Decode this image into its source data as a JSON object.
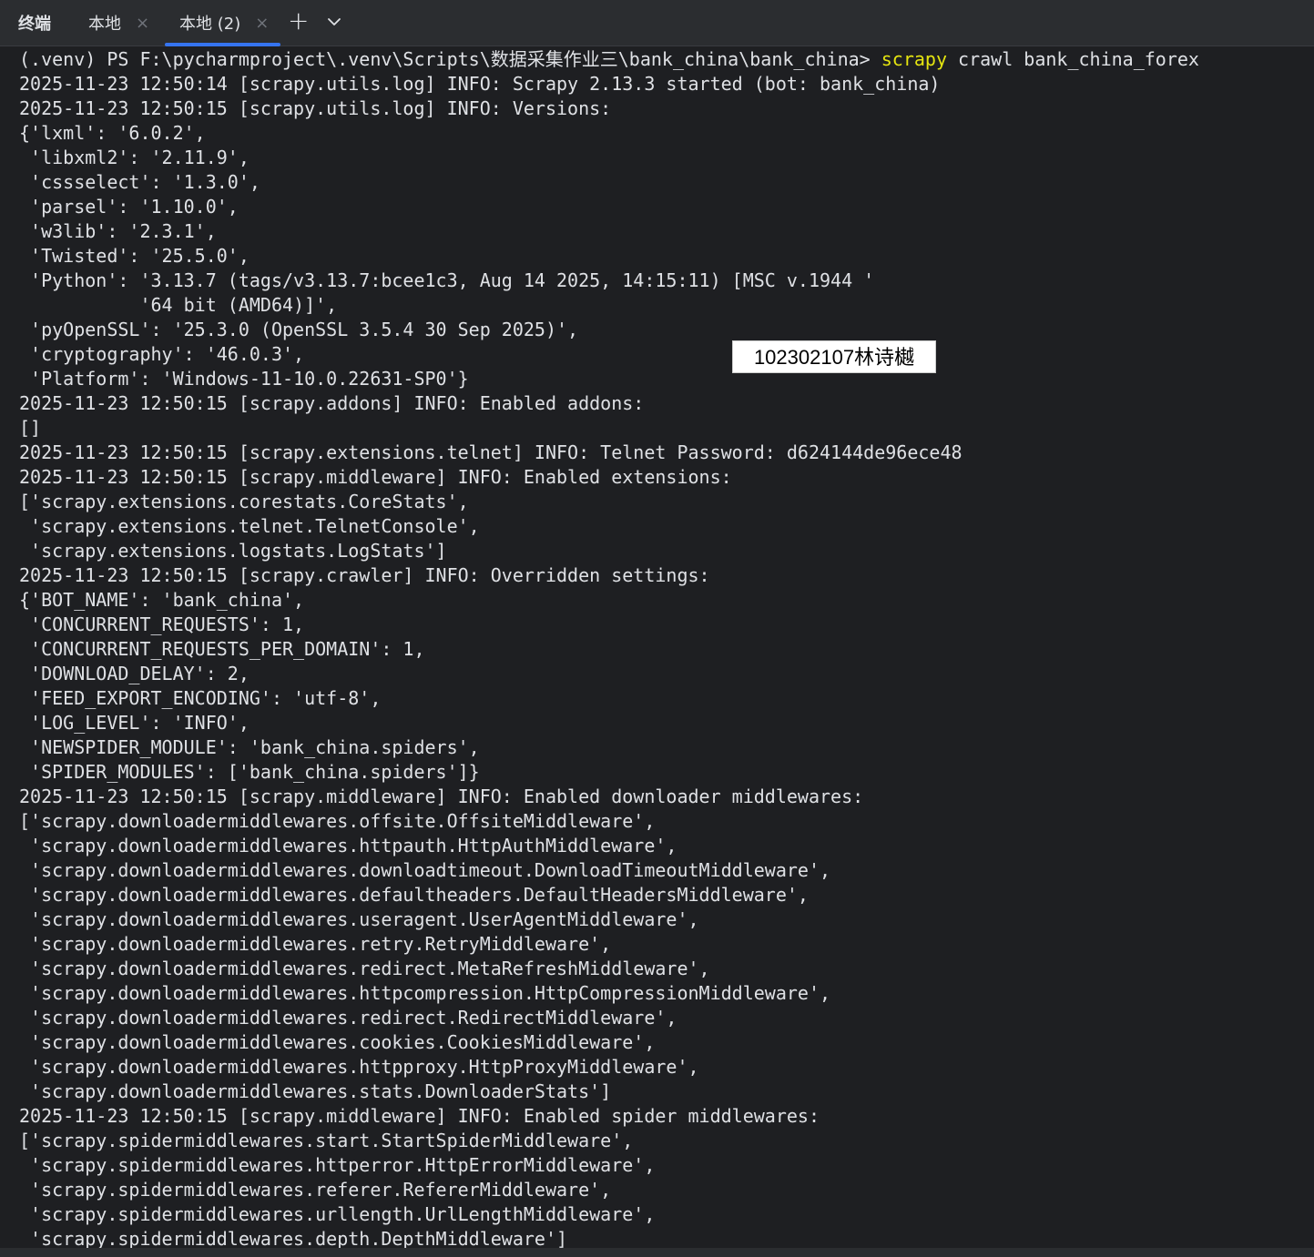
{
  "header": {
    "tool_title": "终端",
    "tabs": [
      {
        "label": "本地",
        "close": "×"
      },
      {
        "label": "本地 (2)",
        "close": "×"
      }
    ],
    "new_tab_symbol": "+"
  },
  "prompt": {
    "path": "(.venv) PS F:\\pycharmproject\\.venv\\Scripts\\数据采集作业三\\bank_china\\bank_china> ",
    "command": "scrapy",
    "args": " crawl bank_china_forex"
  },
  "watermark": "102302107林诗樾",
  "lines": [
    "2025-11-23 12:50:14 [scrapy.utils.log] INFO: Scrapy 2.13.3 started (bot: bank_china)",
    "2025-11-23 12:50:15 [scrapy.utils.log] INFO: Versions:",
    "{'lxml': '6.0.2',",
    " 'libxml2': '2.11.9',",
    " 'cssselect': '1.3.0',",
    " 'parsel': '1.10.0',",
    " 'w3lib': '2.3.1',",
    " 'Twisted': '25.5.0',",
    " 'Python': '3.13.7 (tags/v3.13.7:bcee1c3, Aug 14 2025, 14:15:11) [MSC v.1944 '",
    "           '64 bit (AMD64)]',",
    " 'pyOpenSSL': '25.3.0 (OpenSSL 3.5.4 30 Sep 2025)',",
    " 'cryptography': '46.0.3',",
    " 'Platform': 'Windows-11-10.0.22631-SP0'}",
    "2025-11-23 12:50:15 [scrapy.addons] INFO: Enabled addons:",
    "[]",
    "2025-11-23 12:50:15 [scrapy.extensions.telnet] INFO: Telnet Password: d624144de96ece48",
    "2025-11-23 12:50:15 [scrapy.middleware] INFO: Enabled extensions:",
    "['scrapy.extensions.corestats.CoreStats',",
    " 'scrapy.extensions.telnet.TelnetConsole',",
    " 'scrapy.extensions.logstats.LogStats']",
    "2025-11-23 12:50:15 [scrapy.crawler] INFO: Overridden settings:",
    "{'BOT_NAME': 'bank_china',",
    " 'CONCURRENT_REQUESTS': 1,",
    " 'CONCURRENT_REQUESTS_PER_DOMAIN': 1,",
    " 'DOWNLOAD_DELAY': 2,",
    " 'FEED_EXPORT_ENCODING': 'utf-8',",
    " 'LOG_LEVEL': 'INFO',",
    " 'NEWSPIDER_MODULE': 'bank_china.spiders',",
    " 'SPIDER_MODULES': ['bank_china.spiders']}",
    "2025-11-23 12:50:15 [scrapy.middleware] INFO: Enabled downloader middlewares:",
    "['scrapy.downloadermiddlewares.offsite.OffsiteMiddleware',",
    " 'scrapy.downloadermiddlewares.httpauth.HttpAuthMiddleware',",
    " 'scrapy.downloadermiddlewares.downloadtimeout.DownloadTimeoutMiddleware',",
    " 'scrapy.downloadermiddlewares.defaultheaders.DefaultHeadersMiddleware',",
    " 'scrapy.downloadermiddlewares.useragent.UserAgentMiddleware',",
    " 'scrapy.downloadermiddlewares.retry.RetryMiddleware',",
    " 'scrapy.downloadermiddlewares.redirect.MetaRefreshMiddleware',",
    " 'scrapy.downloadermiddlewares.httpcompression.HttpCompressionMiddleware',",
    " 'scrapy.downloadermiddlewares.redirect.RedirectMiddleware',",
    " 'scrapy.downloadermiddlewares.cookies.CookiesMiddleware',",
    " 'scrapy.downloadermiddlewares.httpproxy.HttpProxyMiddleware',",
    " 'scrapy.downloadermiddlewares.stats.DownloaderStats']",
    "2025-11-23 12:50:15 [scrapy.middleware] INFO: Enabled spider middlewares:",
    "['scrapy.spidermiddlewares.start.StartSpiderMiddleware',",
    " 'scrapy.spidermiddlewares.httperror.HttpErrorMiddleware',",
    " 'scrapy.spidermiddlewares.referer.RefererMiddleware',",
    " 'scrapy.spidermiddlewares.urllength.UrlLengthMiddleware',",
    " 'scrapy.spidermiddlewares.depth.DepthMiddleware']"
  ],
  "colors": {
    "background": "#1e1f22",
    "tabbar": "#2b2d30",
    "text": "#dfe1e5",
    "command": "#e5e510",
    "accent": "#3574f0"
  },
  "icons": {
    "new_tab": "plus-icon",
    "dropdown": "chevron-down-icon",
    "close": "close-icon"
  }
}
